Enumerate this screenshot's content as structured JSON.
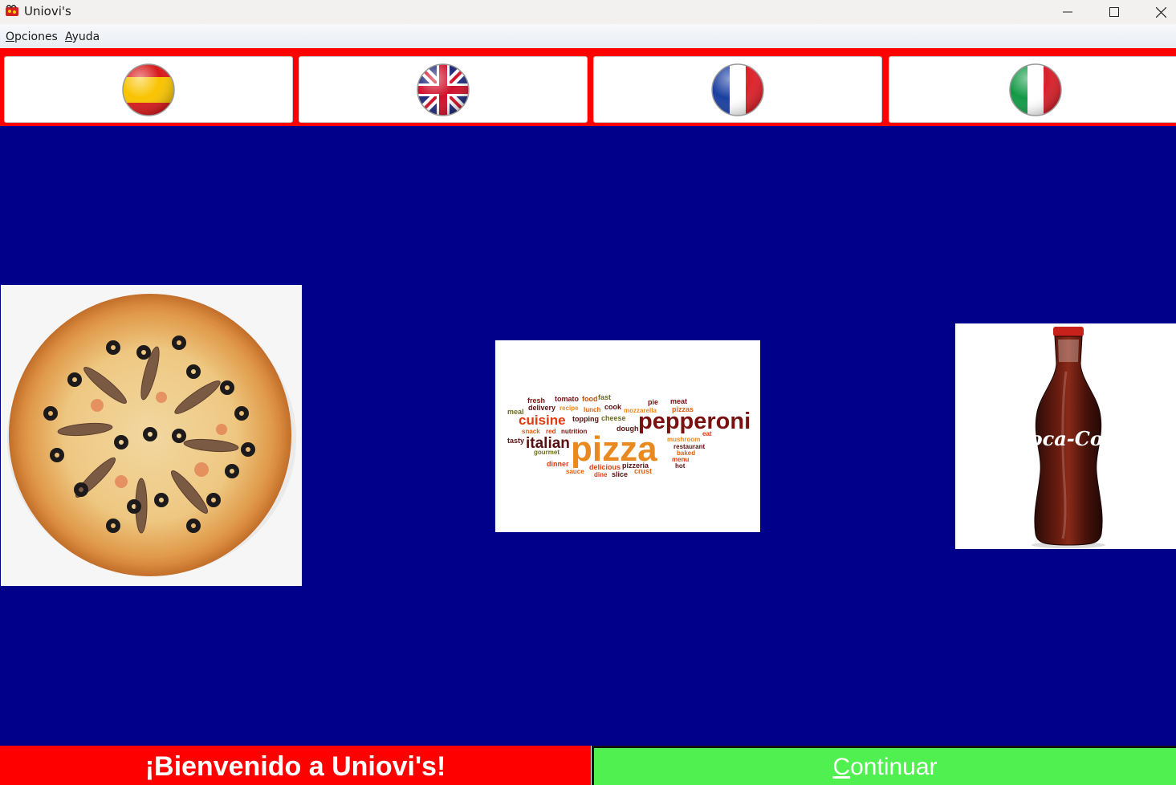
{
  "window": {
    "title": "Uniovi's",
    "controls": [
      "minimize-icon",
      "maximize-icon",
      "close-icon"
    ]
  },
  "menu": {
    "items": [
      {
        "label_first": "O",
        "label_rest": "pciones"
      },
      {
        "label_first": "A",
        "label_rest": "yuda"
      }
    ]
  },
  "languages": [
    {
      "name": "spanish-flag-icon"
    },
    {
      "name": "uk-flag-icon"
    },
    {
      "name": "french-flag-icon"
    },
    {
      "name": "italian-flag-icon"
    }
  ],
  "products": [
    {
      "name": "pizza-image"
    },
    {
      "name": "pizza-word-cloud-image"
    },
    {
      "name": "coca-cola-image"
    }
  ],
  "word_cloud": {
    "pepperoni": "pepperoni",
    "pizza": "pizza",
    "italian": "italian",
    "cuisine": "cuisine",
    "words": [
      "fresh",
      "tomato",
      "food",
      "fast",
      "meal",
      "delivery",
      "recipe",
      "lunch",
      "cook",
      "mozzarella",
      "pie",
      "meat",
      "pizzas",
      "topping",
      "cheese",
      "snack",
      "red",
      "nutrition",
      "dough",
      "eat",
      "mushroom",
      "tasty",
      "restaurant",
      "gourmet",
      "baked",
      "menu",
      "dinner",
      "delicious",
      "pizzeria",
      "hot",
      "sauce",
      "dine",
      "slice",
      "crust"
    ]
  },
  "coke_label": "Coca-Cola",
  "footer": {
    "welcome": "¡Bienvenido a Uniovi's!",
    "continue_first": "C",
    "continue_rest": "ontinuar"
  },
  "colors": {
    "background": "#00008b",
    "accent_red": "#ff0000",
    "continue_green": "#50f050"
  }
}
